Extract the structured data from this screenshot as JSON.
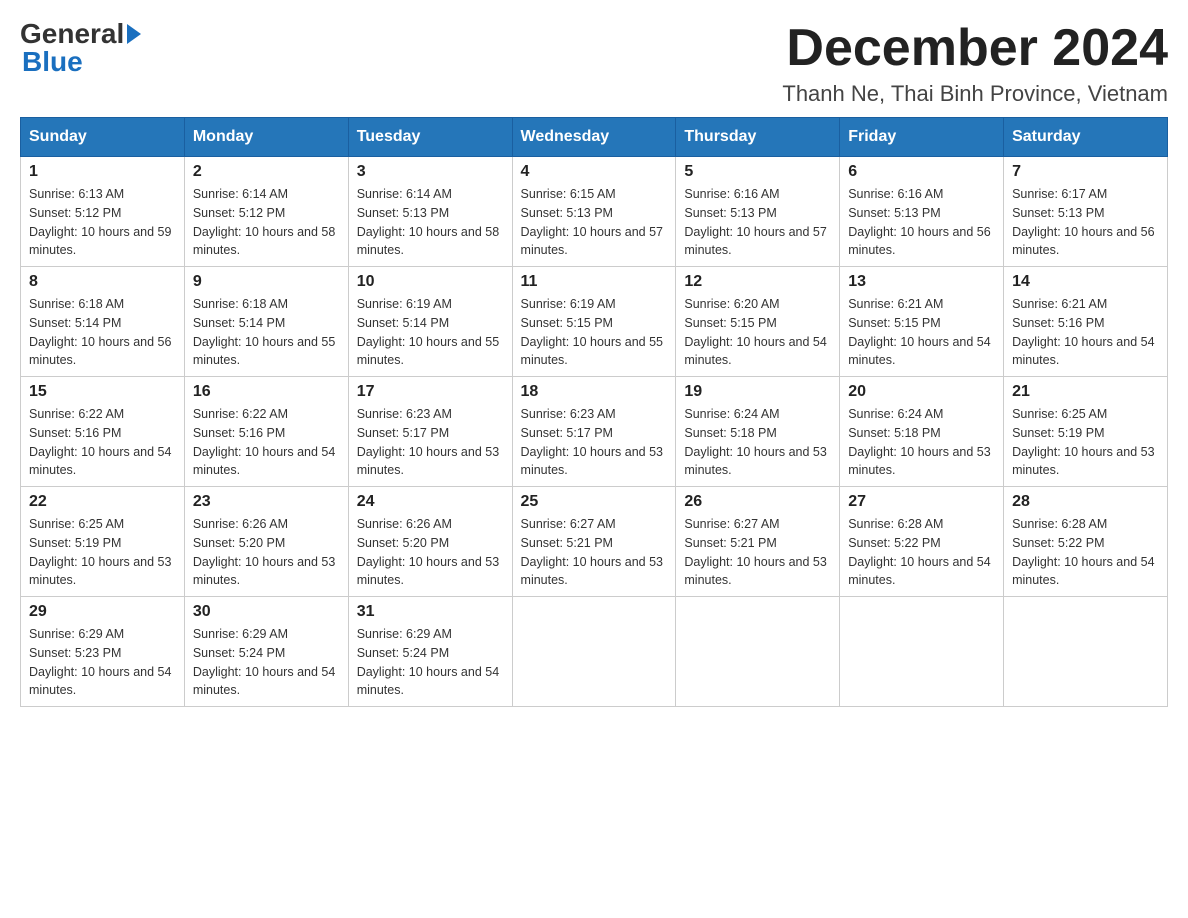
{
  "header": {
    "logo_general": "General",
    "logo_blue": "Blue",
    "month_year": "December 2024",
    "location": "Thanh Ne, Thai Binh Province, Vietnam"
  },
  "weekdays": [
    "Sunday",
    "Monday",
    "Tuesday",
    "Wednesday",
    "Thursday",
    "Friday",
    "Saturday"
  ],
  "weeks": [
    [
      {
        "day": "1",
        "sunrise": "6:13 AM",
        "sunset": "5:12 PM",
        "daylight": "10 hours and 59 minutes."
      },
      {
        "day": "2",
        "sunrise": "6:14 AM",
        "sunset": "5:12 PM",
        "daylight": "10 hours and 58 minutes."
      },
      {
        "day": "3",
        "sunrise": "6:14 AM",
        "sunset": "5:13 PM",
        "daylight": "10 hours and 58 minutes."
      },
      {
        "day": "4",
        "sunrise": "6:15 AM",
        "sunset": "5:13 PM",
        "daylight": "10 hours and 57 minutes."
      },
      {
        "day": "5",
        "sunrise": "6:16 AM",
        "sunset": "5:13 PM",
        "daylight": "10 hours and 57 minutes."
      },
      {
        "day": "6",
        "sunrise": "6:16 AM",
        "sunset": "5:13 PM",
        "daylight": "10 hours and 56 minutes."
      },
      {
        "day": "7",
        "sunrise": "6:17 AM",
        "sunset": "5:13 PM",
        "daylight": "10 hours and 56 minutes."
      }
    ],
    [
      {
        "day": "8",
        "sunrise": "6:18 AM",
        "sunset": "5:14 PM",
        "daylight": "10 hours and 56 minutes."
      },
      {
        "day": "9",
        "sunrise": "6:18 AM",
        "sunset": "5:14 PM",
        "daylight": "10 hours and 55 minutes."
      },
      {
        "day": "10",
        "sunrise": "6:19 AM",
        "sunset": "5:14 PM",
        "daylight": "10 hours and 55 minutes."
      },
      {
        "day": "11",
        "sunrise": "6:19 AM",
        "sunset": "5:15 PM",
        "daylight": "10 hours and 55 minutes."
      },
      {
        "day": "12",
        "sunrise": "6:20 AM",
        "sunset": "5:15 PM",
        "daylight": "10 hours and 54 minutes."
      },
      {
        "day": "13",
        "sunrise": "6:21 AM",
        "sunset": "5:15 PM",
        "daylight": "10 hours and 54 minutes."
      },
      {
        "day": "14",
        "sunrise": "6:21 AM",
        "sunset": "5:16 PM",
        "daylight": "10 hours and 54 minutes."
      }
    ],
    [
      {
        "day": "15",
        "sunrise": "6:22 AM",
        "sunset": "5:16 PM",
        "daylight": "10 hours and 54 minutes."
      },
      {
        "day": "16",
        "sunrise": "6:22 AM",
        "sunset": "5:16 PM",
        "daylight": "10 hours and 54 minutes."
      },
      {
        "day": "17",
        "sunrise": "6:23 AM",
        "sunset": "5:17 PM",
        "daylight": "10 hours and 53 minutes."
      },
      {
        "day": "18",
        "sunrise": "6:23 AM",
        "sunset": "5:17 PM",
        "daylight": "10 hours and 53 minutes."
      },
      {
        "day": "19",
        "sunrise": "6:24 AM",
        "sunset": "5:18 PM",
        "daylight": "10 hours and 53 minutes."
      },
      {
        "day": "20",
        "sunrise": "6:24 AM",
        "sunset": "5:18 PM",
        "daylight": "10 hours and 53 minutes."
      },
      {
        "day": "21",
        "sunrise": "6:25 AM",
        "sunset": "5:19 PM",
        "daylight": "10 hours and 53 minutes."
      }
    ],
    [
      {
        "day": "22",
        "sunrise": "6:25 AM",
        "sunset": "5:19 PM",
        "daylight": "10 hours and 53 minutes."
      },
      {
        "day": "23",
        "sunrise": "6:26 AM",
        "sunset": "5:20 PM",
        "daylight": "10 hours and 53 minutes."
      },
      {
        "day": "24",
        "sunrise": "6:26 AM",
        "sunset": "5:20 PM",
        "daylight": "10 hours and 53 minutes."
      },
      {
        "day": "25",
        "sunrise": "6:27 AM",
        "sunset": "5:21 PM",
        "daylight": "10 hours and 53 minutes."
      },
      {
        "day": "26",
        "sunrise": "6:27 AM",
        "sunset": "5:21 PM",
        "daylight": "10 hours and 53 minutes."
      },
      {
        "day": "27",
        "sunrise": "6:28 AM",
        "sunset": "5:22 PM",
        "daylight": "10 hours and 54 minutes."
      },
      {
        "day": "28",
        "sunrise": "6:28 AM",
        "sunset": "5:22 PM",
        "daylight": "10 hours and 54 minutes."
      }
    ],
    [
      {
        "day": "29",
        "sunrise": "6:29 AM",
        "sunset": "5:23 PM",
        "daylight": "10 hours and 54 minutes."
      },
      {
        "day": "30",
        "sunrise": "6:29 AM",
        "sunset": "5:24 PM",
        "daylight": "10 hours and 54 minutes."
      },
      {
        "day": "31",
        "sunrise": "6:29 AM",
        "sunset": "5:24 PM",
        "daylight": "10 hours and 54 minutes."
      },
      null,
      null,
      null,
      null
    ]
  ]
}
